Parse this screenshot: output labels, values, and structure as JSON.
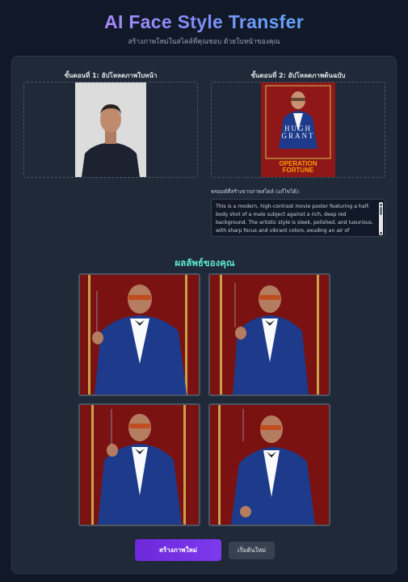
{
  "header": {
    "title": "AI Face Style Transfer",
    "subtitle": "สร้างภาพใหม่ในสไตล์ที่คุณชอบ ด้วยใบหน้าของคุณ"
  },
  "step1": {
    "label": "ขั้นตอนที่ 1: อัปโหลดภาพใบหน้า"
  },
  "step2": {
    "label": "ขั้นตอนที่ 2: อัปโหลดภาพต้นฉบับ"
  },
  "poster": {
    "line1": "HUGH",
    "line2": "GRANT",
    "title1": "OPERATION",
    "title2": "FORTUNE"
  },
  "prompt": {
    "label": "พรอมต์ที่สร้างจากภาพสไตล์ (แก้ไขได้):",
    "text": "This is a modern, high-contrast movie poster featuring a half-body shot of a male subject against a rich, deep red background. The artistic style is sleek, polished, and luxurious, with sharp focus and vibrant colors, exuding an air of sophisticated villainy. A stylized, incomplete golden rectangular frame partially encloses the subject"
  },
  "results": {
    "title": "ผลลัพธ์ของคุณ"
  },
  "buttons": {
    "generate": "สร้างภาพใหม่",
    "restart": "เริ่มต้นใหม่"
  }
}
